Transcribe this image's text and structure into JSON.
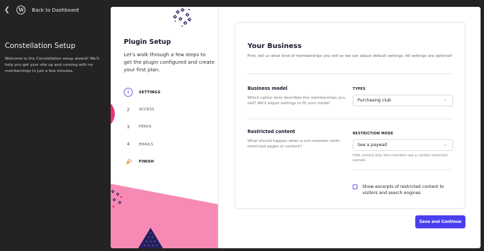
{
  "topbar": {
    "back_label": "Back to Dashboard"
  },
  "sidebar": {
    "title": "Constellation Setup",
    "description": "Welcome to the Constellation setup wizard! We'll help you get your site up and running with no memberships in just a few minutes."
  },
  "plugin": {
    "title": "Plugin Setup",
    "description": "Let's walk through a few steps to get the plugin configured and create your first plan."
  },
  "steps": [
    {
      "num": "1",
      "label": "SETTINGS"
    },
    {
      "num": "2",
      "label": "ACCESS"
    },
    {
      "num": "3",
      "label": "PERKS"
    },
    {
      "num": "4",
      "label": "EMAILS"
    },
    {
      "num": "",
      "label": "FINISH"
    }
  ],
  "form": {
    "title": "Your Business",
    "description": "First, tell us what kind of memberships you sell so we can adjust default settings. All settings are optional!",
    "business_model": {
      "title": "Business model",
      "description": "Which option best describes the memberships you sell? We'll adjust settings to fit your model.",
      "field_label": "TYPES",
      "value": "Purchasing club"
    },
    "restricted_content": {
      "title": "Restricted content",
      "description": "What should happen when a non-member visits restricted pages or content?",
      "field_label": "RESTRICTION MODE",
      "value": "See a paywall",
      "help": "Hide content only. Non-members see a content restricted paywall."
    },
    "excerpts_checkbox": {
      "label": "Show excerpts of restricted content to visitors and search engines",
      "checked": false
    }
  },
  "actions": {
    "save_label": "Save and Continue"
  },
  "colors": {
    "accent": "#4a3ff0",
    "pink": "#f78ab4",
    "magenta": "#e8337a",
    "navy": "#22205f",
    "sidebar_bg": "#232323"
  },
  "icons": {
    "back": "chevron-left-icon",
    "wordpress": "wordpress-logo-icon",
    "select": "chevron-down-icon",
    "finish": "party-popper-icon"
  }
}
